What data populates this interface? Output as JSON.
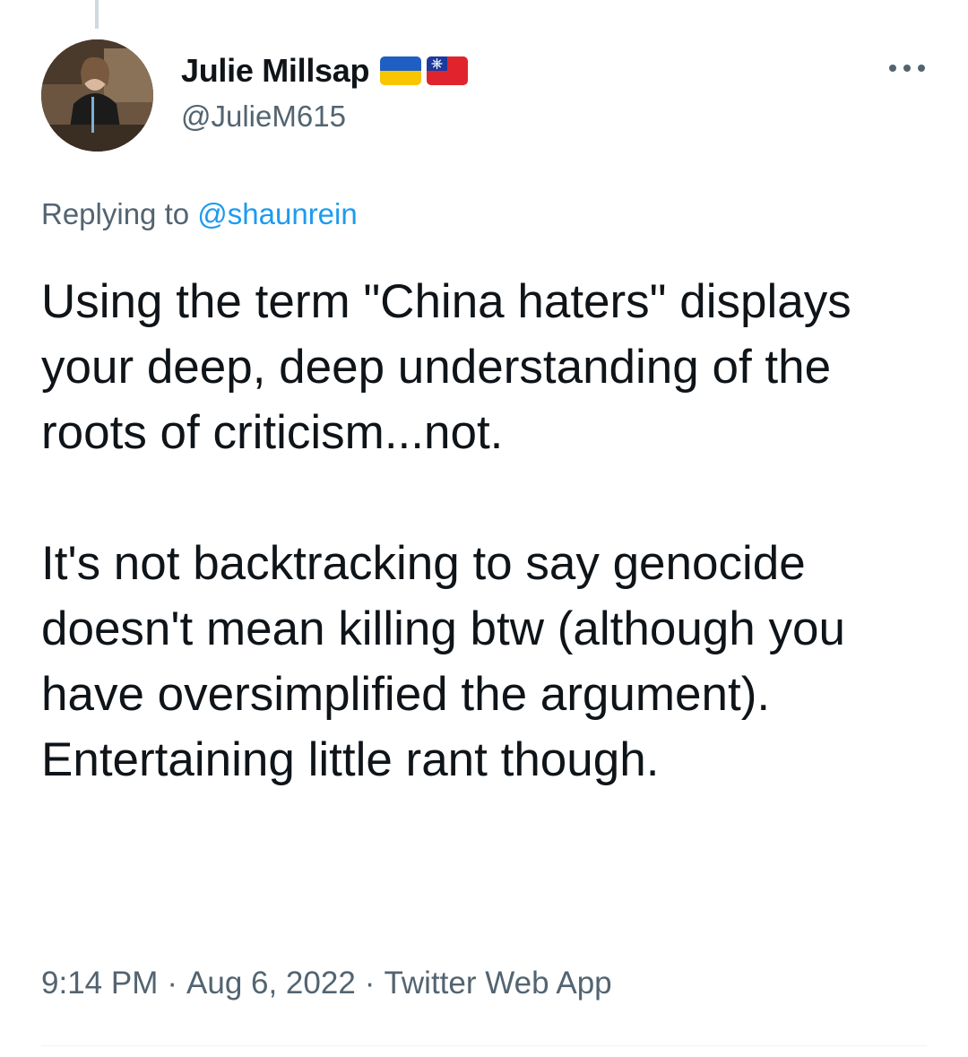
{
  "tweet": {
    "author": {
      "display_name": "Julie Millsap",
      "handle": "@JulieM615",
      "flags": [
        "ukraine-flag",
        "taiwan-flag"
      ]
    },
    "reply": {
      "prefix": "Replying to",
      "mention": "@shaunrein"
    },
    "text": {
      "paragraph_1": "Using the term \"China haters\" displays your deep, deep understanding of the roots of criticism...not.",
      "paragraph_2": "It's not backtracking to say genocide doesn't mean killing btw (although you have oversimplified the argument). Entertaining little rant though."
    },
    "meta": {
      "time": "9:14 PM",
      "date": "Aug 6, 2022",
      "source": "Twitter Web App",
      "separator": "·"
    },
    "more_icon": "more-horizontal-icon"
  },
  "colors": {
    "text_primary": "#0f1419",
    "text_secondary": "#536471",
    "link": "#1d9bf0",
    "thread_line": "#cfd9de",
    "divider": "#eff3f4"
  }
}
